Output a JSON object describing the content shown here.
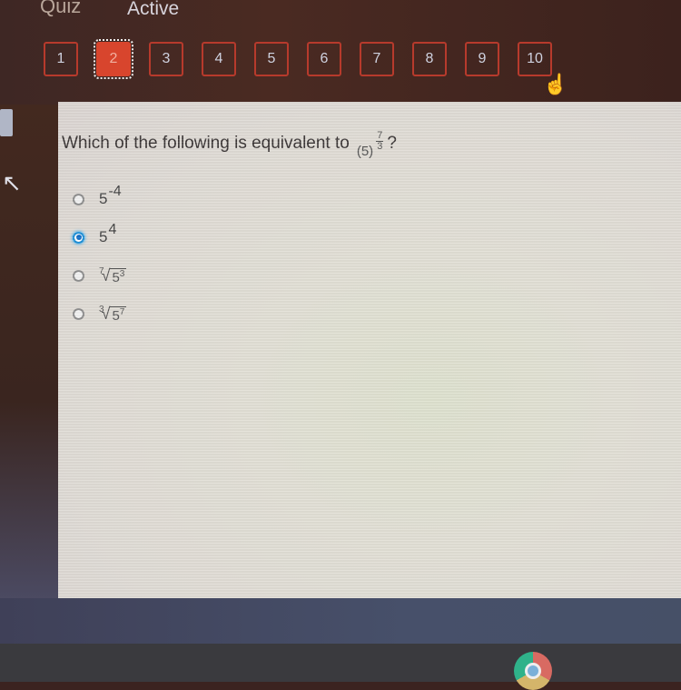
{
  "header": {
    "tabs": [
      {
        "label": "Quiz"
      },
      {
        "label": "Active"
      }
    ]
  },
  "question_nav": {
    "current": 2,
    "items": [
      "1",
      "2",
      "3",
      "4",
      "5",
      "6",
      "7",
      "8",
      "9",
      "10"
    ]
  },
  "question": {
    "text": "Which of the following is equivalent to",
    "expression": {
      "base": "(5)",
      "exp_num": "7",
      "exp_den": "3"
    },
    "suffix": "?"
  },
  "options": [
    {
      "base": "5",
      "exponent": "-4",
      "selected": false
    },
    {
      "base": "5",
      "exponent": "4",
      "selected": true
    },
    {
      "root_index": "7",
      "radicand_base": "5",
      "radicand_exp": "3",
      "selected": false
    },
    {
      "root_index": "3",
      "radicand_base": "5",
      "radicand_exp": "7",
      "selected": false
    }
  ],
  "colors": {
    "current_question": "#d8452d",
    "nav_border": "#b73a2c",
    "radio_selected": "#1570c8"
  },
  "taskbar": {
    "apps": [
      "chrome-icon"
    ]
  }
}
